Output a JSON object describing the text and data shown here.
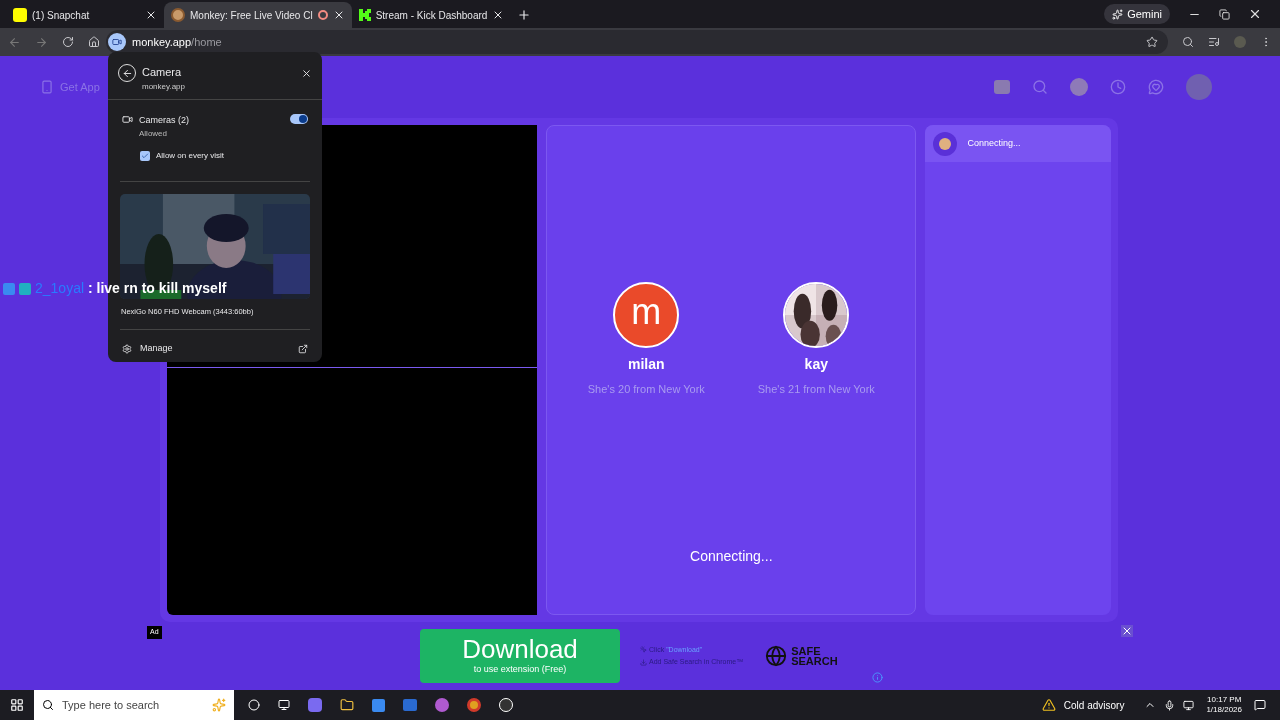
{
  "browser": {
    "tabs": [
      {
        "title": "(1) Snapchat",
        "selected": false,
        "recording": false,
        "kind": "ghost"
      },
      {
        "title": "Monkey: Free Live Video Cl",
        "selected": true,
        "recording": true,
        "kind": "monkey"
      },
      {
        "title": "Stream - Kick Dashboard",
        "selected": false,
        "recording": false,
        "kind": "kick"
      }
    ],
    "gemini": "Gemini",
    "url": {
      "host": "monkey.app",
      "path": "/home"
    }
  },
  "site": {
    "get_app": "Get App",
    "matches": [
      {
        "kind": "letter",
        "initial": "m",
        "name": "milan",
        "bio": "She's 20 from New York"
      },
      {
        "kind": "picture",
        "name": "kay",
        "bio": "She's 21 from New York"
      }
    ],
    "status": "Connecting...",
    "chat": {
      "status": "Connecting..."
    }
  },
  "ad": {
    "label": "Ad",
    "button_title": "Download",
    "button_subtitle": "to use extension (Free)",
    "step_1": "Click",
    "step_1_link": "\"Download\"",
    "step_2": "Add Safe Search in Chrome™",
    "logo_line_1": "SAFE",
    "logo_line_2": "SEARCH"
  },
  "permission_popup": {
    "title": "Camera",
    "site": "monkey.app",
    "setting": "Cameras (2)",
    "setting_status": "Allowed",
    "on": true,
    "always_allow": {
      "label": "Allow on every visit",
      "checked": true
    },
    "device": "NexiGo N60 FHD Webcam (3443:60bb)",
    "manage": "Manage"
  },
  "stream_chat": {
    "user": "2_1oyal",
    "separator": ":",
    "message": "live rn to kill myself"
  },
  "taskbar": {
    "search_placeholder": "Type here to search",
    "weather": "Cold advisory",
    "time": "10:17 PM",
    "date": "1/18/2026"
  }
}
